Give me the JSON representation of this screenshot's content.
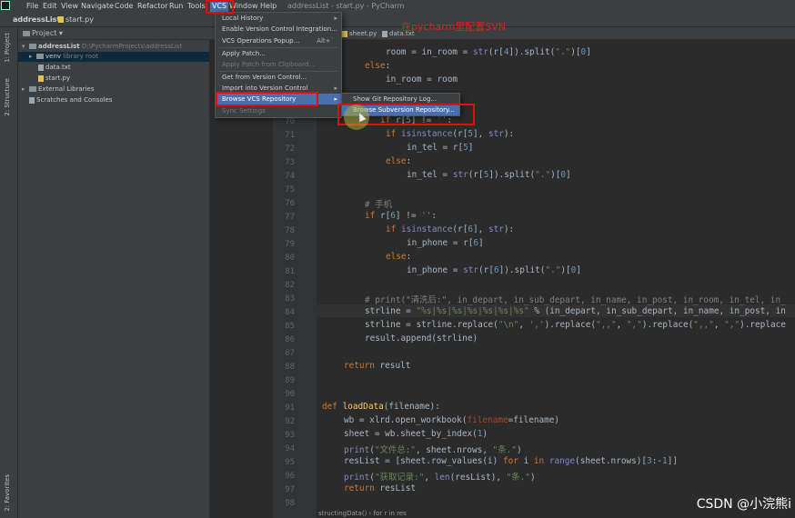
{
  "window_title": "addressList - start.py - PyCharm",
  "menu": [
    "File",
    "Edit",
    "View",
    "Navigate",
    "Code",
    "Refactor",
    "Run",
    "Tools",
    "VCS",
    "Window",
    "Help"
  ],
  "navbar": {
    "project": "addressList",
    "file": "start.py"
  },
  "side_tabs": {
    "project": "1: Project",
    "structure": "2: Structure",
    "favorites": "2: Favorites"
  },
  "project_panel": {
    "header": "Project",
    "root": {
      "name": "addressList",
      "path": "D:\\PycharmProjects\\addressList"
    },
    "venv": {
      "name": "venv",
      "note": "library root"
    },
    "files": [
      "data.txt",
      "start.py"
    ],
    "external": "External Libraries",
    "scratches": "Scratches and Consoles"
  },
  "editor_tabs": [
    "sheet.py",
    "data.txt"
  ],
  "annotation": "在pycharm里配置SVN",
  "vcs_menu": {
    "local_history": "Local History",
    "enable_vcs": "Enable Version Control Integration...",
    "vcs_operations": "VCS Operations Popup...",
    "vcs_operations_shortcut": "Alt+`",
    "apply_patch": "Apply Patch...",
    "apply_patch_clipboard": "Apply Patch from Clipboard...",
    "get_from_vc": "Get from Version Control...",
    "import_vc": "Import into Version Control",
    "browse_vcs": "Browse VCS Repository",
    "sync_settings": "Sync Settings"
  },
  "browse_submenu": {
    "git_log": "Show Git Repository Log...",
    "svn": "Browse Subversion Repository..."
  },
  "line_numbers": [
    "70",
    "71",
    "72",
    "73",
    "74",
    "75",
    "76",
    "77",
    "78",
    "79",
    "80",
    "81",
    "82",
    "83",
    "84",
    "85",
    "86",
    "87",
    "88",
    "89",
    "90",
    "91",
    "92",
    "93",
    "94",
    "95",
    "96",
    "97",
    "98"
  ],
  "bottom_breadcrumb": {
    "a": "structingData()",
    "b": "for r in res"
  },
  "watermark": "CSDN @小浣熊i",
  "colors": {
    "accent": "#4b6eaf",
    "annotation_red": "#e01010",
    "bg": "#2b2b2b"
  }
}
